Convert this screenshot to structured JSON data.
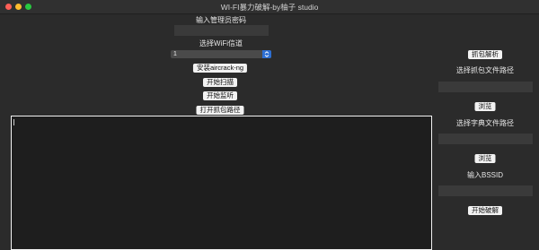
{
  "window": {
    "title": "WI-FI暴力破解-by柚子 studio"
  },
  "left": {
    "admin_password_label": "输入管理员密码",
    "admin_password_value": "",
    "channel_label": "选择WiFi信道",
    "channel_selected": "1",
    "install_button": "安装aircrack-ng",
    "scan_button": "开始扫描",
    "listen_button": "开始监听",
    "open_path_button": "打开抓包路径",
    "log_text": ""
  },
  "right": {
    "parse_button": "抓包解析",
    "capture_path_label": "选择抓包文件路径",
    "capture_path_value": "",
    "browse_button_1": "浏览",
    "dict_path_label": "选择字典文件路径",
    "dict_path_value": "",
    "browse_button_2": "浏览",
    "bssid_label": "输入BSSID",
    "bssid_value": "",
    "crack_button": "开始破解"
  },
  "colors": {
    "background": "#2b2b2b",
    "field": "#3a3a3a",
    "button": "#f2f2f2",
    "accent": "#2d6fd3",
    "log_bg": "#1e1e1e"
  }
}
